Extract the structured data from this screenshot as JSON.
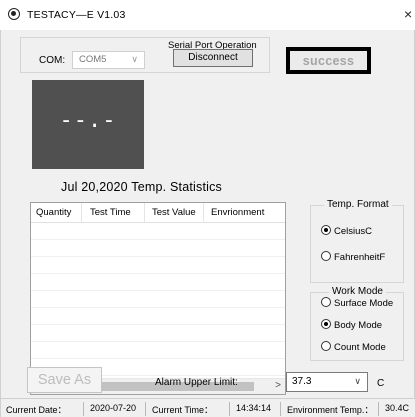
{
  "window": {
    "title": "TESTACY—E   V1.03",
    "close_glyph": "×"
  },
  "serial": {
    "caption": "Serial Port Operation",
    "com_label": "COM:",
    "com_value": "COM5",
    "disconnect_label": "Disconnect",
    "status_text": "success"
  },
  "display": {
    "value": "--.-"
  },
  "stats": {
    "title": "Jul 20,2020 Temp. Statistics",
    "columns": [
      "Quantity",
      "Test Time",
      "Test Value",
      "Envrionment"
    ]
  },
  "temp_format": {
    "caption": "Temp. Format",
    "options": [
      "CelsiusC",
      "FahrenheitF"
    ],
    "selected": "CelsiusC"
  },
  "work_mode": {
    "caption": "Work Mode",
    "options": [
      "Surface Mode",
      "Body Mode",
      "Count Mode"
    ],
    "selected": "Body Mode"
  },
  "controls": {
    "save_as_label": "Save As",
    "alarm_label": "Alarm Upper Limit:",
    "alarm_value": "37.3",
    "alarm_unit": "C"
  },
  "statusbar": {
    "date_label": "Current Date：",
    "date_value": "2020-07-20",
    "time_label": "Current Time：",
    "time_value": "14:34:14",
    "env_label": "Environment Temp.：",
    "env_value": "30.4C"
  },
  "icons": {
    "app": "app-target-icon",
    "chevron": "chevron-down-icon",
    "scroll_left": "scroll-left-icon",
    "scroll_right": "scroll-right-icon"
  },
  "colors": {
    "display_bg": "#505050",
    "success_text": "#a5a5a5",
    "window_bg": "#f0f0f0"
  }
}
